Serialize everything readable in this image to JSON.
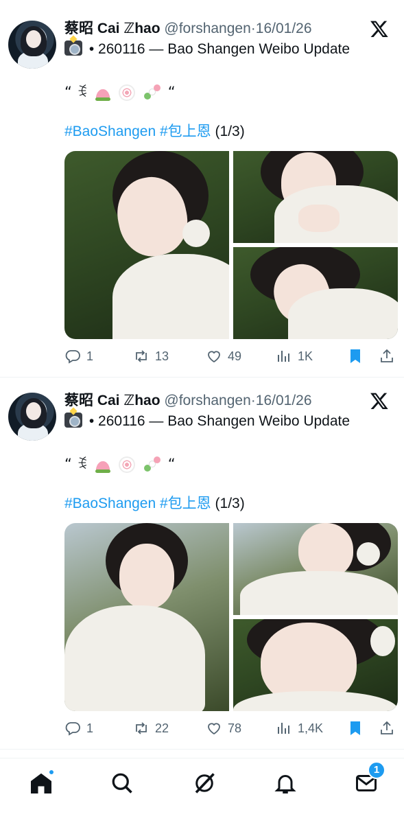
{
  "tweets": [
    {
      "author_name": "蔡昭 Cai ℤhao",
      "handle": "@forshangen",
      "separator": "·",
      "date": "16/01/26",
      "subline_bullet": "•",
      "subline_text": "260116 — Bao Shangen Weibo Update",
      "quote_open": "“",
      "quote_glyph": "ꉂ",
      "quote_close": "“",
      "hashtags": [
        "#BaoShangen",
        "#包上恩"
      ],
      "counter": "(1/3)",
      "stats": {
        "replies": "1",
        "reposts": "13",
        "likes": "49",
        "views": "1K"
      },
      "bookmarked": true
    },
    {
      "author_name": "蔡昭 Cai ℤhao",
      "handle": "@forshangen",
      "separator": "·",
      "date": "16/01/26",
      "subline_bullet": "•",
      "subline_text": "260116 — Bao Shangen Weibo Update",
      "quote_open": "“",
      "quote_glyph": "ꉂ",
      "quote_close": "“",
      "hashtags": [
        "#BaoShangen",
        "#包上恩"
      ],
      "counter": "(1/3)",
      "stats": {
        "replies": "1",
        "reposts": "22",
        "likes": "78",
        "views": "1,4K"
      },
      "bookmarked": true
    }
  ],
  "bottom_nav": {
    "items": [
      "home-icon",
      "search-icon",
      "grok-icon",
      "notifications-icon",
      "messages-icon"
    ],
    "messages_badge": "1"
  },
  "colors": {
    "accent": "#1d9bf0",
    "muted": "#536471",
    "text": "#0f1419",
    "divider": "#eff3f4"
  }
}
